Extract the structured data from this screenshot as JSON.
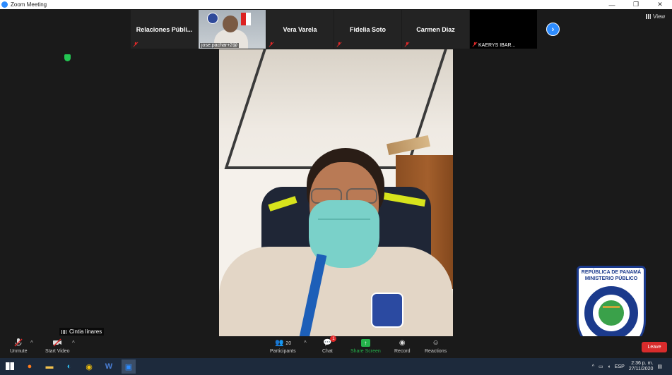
{
  "window": {
    "title": "Zoom Meeting",
    "minimize": "—",
    "maximize": "❐",
    "close": "✕"
  },
  "thumbnails": [
    {
      "name": "Relaciones  Públi...",
      "muted": true
    },
    {
      "label": "jose.pachar+2@",
      "video": true
    },
    {
      "name": "Vera Varela",
      "muted": true
    },
    {
      "name": "Fidelia Soto",
      "muted": true
    },
    {
      "name": "Carmen Diaz",
      "muted": true
    },
    {
      "label": "KAERYS IBAR...",
      "muted": true,
      "dark": true
    }
  ],
  "view_button": "View",
  "speaker_name": "Cintia linares",
  "seal": {
    "line1": "REPÚBLICA DE PANAMÁ",
    "line2": "MINISTERIO PÚBLICO",
    "ring_text": "INSTITUTO DE MEDICINA LEGAL Y CIENCIAS FORENSES"
  },
  "toolbar": {
    "unmute": "Unmute",
    "start_video": "Start Video",
    "participants": "Participants",
    "participants_count": "20",
    "chat": "Chat",
    "chat_badge": "1",
    "share_screen": "Share Screen",
    "record": "Record",
    "reactions": "Reactions",
    "leave": "Leave"
  },
  "taskbar": {
    "tray_caret": "^",
    "language": "ESP",
    "time": "2:36 p. m.",
    "date": "27/11/2020"
  },
  "colors": {
    "zoom_blue": "#2d8cff",
    "share_green": "#24b24b",
    "leave_red": "#d92c2c",
    "mic_red": "#e02828"
  }
}
